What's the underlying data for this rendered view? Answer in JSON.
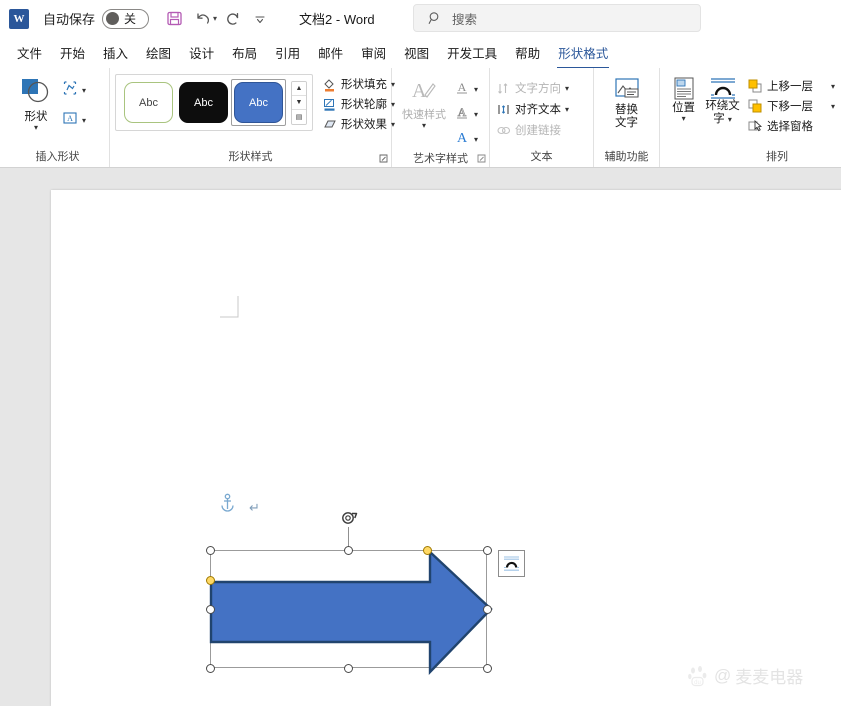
{
  "titlebar": {
    "app_logo": "word-logo",
    "autosave_label": "自动保存",
    "autosave_state": "关",
    "quick_access": [
      {
        "name": "save-icon",
        "label": "保存"
      },
      {
        "name": "undo-icon",
        "label": "撤销"
      },
      {
        "name": "redo-icon",
        "label": "恢复"
      },
      {
        "name": "customize-qat-icon",
        "label": "自定义快速访问工具栏"
      }
    ],
    "document_title": "文档2  -  Word"
  },
  "search": {
    "icon": "search-icon",
    "placeholder": "搜索"
  },
  "tabs": [
    {
      "label": "文件",
      "active": false
    },
    {
      "label": "开始",
      "active": false
    },
    {
      "label": "插入",
      "active": false
    },
    {
      "label": "绘图",
      "active": false
    },
    {
      "label": "设计",
      "active": false
    },
    {
      "label": "布局",
      "active": false
    },
    {
      "label": "引用",
      "active": false
    },
    {
      "label": "邮件",
      "active": false
    },
    {
      "label": "审阅",
      "active": false
    },
    {
      "label": "视图",
      "active": false
    },
    {
      "label": "开发工具",
      "active": false
    },
    {
      "label": "帮助",
      "active": false
    },
    {
      "label": "形状格式",
      "active": true
    }
  ],
  "ribbon": {
    "groups": [
      {
        "id": "insert-shapes",
        "label": "插入形状",
        "shapes_button": "形状",
        "side_items": [
          {
            "name": "edit-shape-icon",
            "label": "编辑形状"
          },
          {
            "name": "draw-textbox-icon",
            "label": "绘制文本框"
          }
        ]
      },
      {
        "id": "shape-styles",
        "label": "形状样式",
        "thumbs": [
          {
            "text": "Abc",
            "style": "outline-green"
          },
          {
            "text": "Abc",
            "style": "fill-black"
          },
          {
            "text": "Abc",
            "style": "fill-blue-selected"
          }
        ],
        "commands": [
          {
            "name": "shape-fill-icon",
            "label": "形状填充",
            "caret": true
          },
          {
            "name": "shape-outline-icon",
            "label": "形状轮廓",
            "caret": true
          },
          {
            "name": "shape-effects-icon",
            "label": "形状效果",
            "caret": true
          }
        ],
        "has_dialog_launcher": true
      },
      {
        "id": "wordart-styles",
        "label": "艺术字样式",
        "quick_styles_label": "快速样式",
        "letter_items": [
          {
            "name": "text-fill-icon",
            "glyph": "A",
            "color": "#6b6b6b",
            "caret": true
          },
          {
            "name": "text-outline-icon",
            "glyph": "A",
            "color": "#6b6b6b",
            "caret": true
          },
          {
            "name": "text-effects-icon",
            "glyph": "A",
            "color": "#2b7cd3",
            "caret": true
          }
        ],
        "has_dialog_launcher": true
      },
      {
        "id": "text",
        "label": "文本",
        "commands": [
          {
            "name": "text-direction-icon",
            "label": "文字方向",
            "caret": true,
            "disabled": true
          },
          {
            "name": "align-text-icon",
            "label": "对齐文本",
            "caret": true,
            "disabled": false
          },
          {
            "name": "create-link-icon",
            "label": "创建链接",
            "caret": false,
            "disabled": true
          }
        ]
      },
      {
        "id": "accessibility",
        "label": "辅助功能",
        "alt_text_label": "替换\n文字"
      },
      {
        "id": "arrange",
        "label": "排列",
        "position_label": "位置",
        "wrap_text_label": "环绕文\n字",
        "commands": [
          {
            "name": "bring-forward-icon",
            "label": "上移一层",
            "caret": true
          },
          {
            "name": "send-backward-icon",
            "label": "下移一层",
            "caret": true
          },
          {
            "name": "selection-pane-icon",
            "label": "选择窗格",
            "caret": false
          }
        ]
      }
    ]
  },
  "canvas": {
    "shape": {
      "name": "right-arrow-shape",
      "fill_color": "#4472C4",
      "outline_color": "#21446E",
      "selected": true
    },
    "selection": {
      "handle_color": "#FFFFFF",
      "adjust_handle_color": "#FFD966",
      "frame_color": "#9B9B9B"
    },
    "anchor_icon": "anchor-icon",
    "paragraph_mark": "↵",
    "layout_options_icon": "layout-options-icon",
    "rotate_handle_icon": "rotate-handle-icon"
  },
  "watermark": {
    "logo": "baidu-logo",
    "at": "@",
    "text": "麦麦电器"
  }
}
